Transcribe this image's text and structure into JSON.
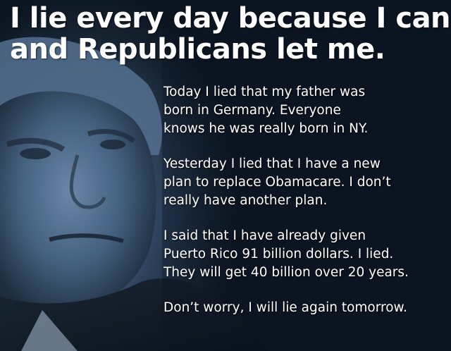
{
  "headline": {
    "line1": "I lie every day because I can",
    "line2": "and Republicans let me."
  },
  "paragraphs": [
    {
      "lines": [
        "Today I lied that my father was",
        "born in Germany.  Everyone",
        "knows he was really born in NY."
      ]
    },
    {
      "lines": [
        "Yesterday I lied that I have a new",
        "plan to replace Obamacare. I don’t",
        "really have another plan."
      ]
    },
    {
      "lines": [
        "I said that I have already given",
        "Puerto Rico 91 billion dollars. I lied.",
        "They will get 40 billion over 20 years."
      ]
    },
    {
      "lines": [
        "Don’t worry, I will lie again tomorrow."
      ]
    }
  ]
}
